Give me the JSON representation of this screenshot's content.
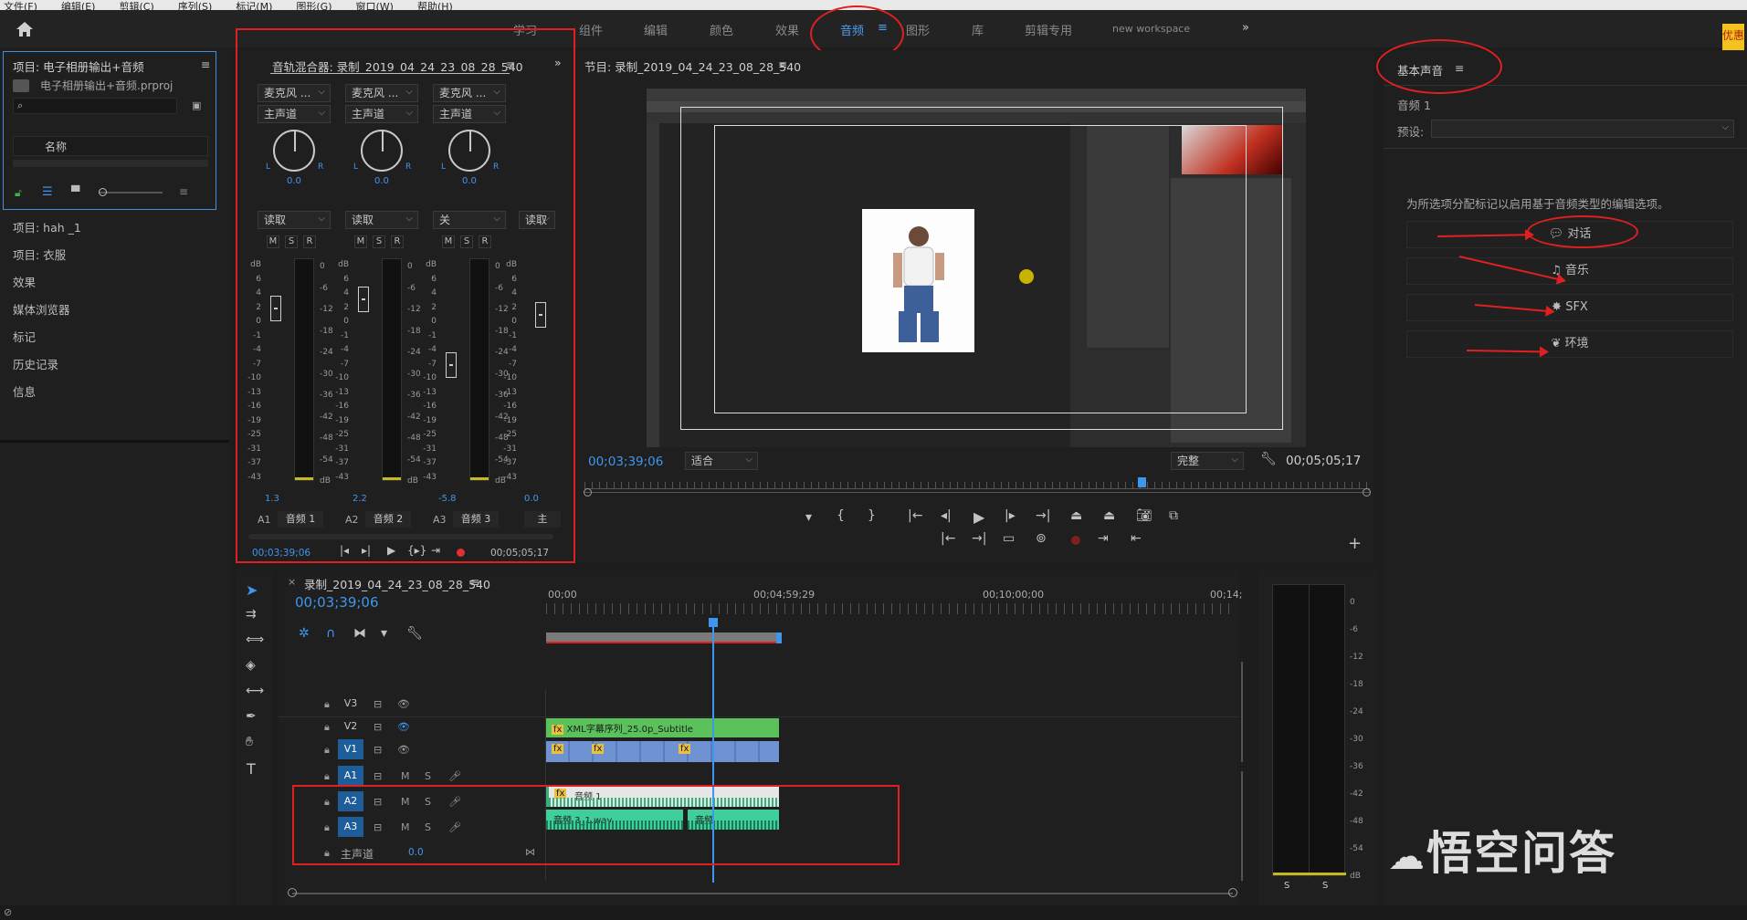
{
  "menu": [
    "文件(F)",
    "编辑(E)",
    "剪辑(C)",
    "序列(S)",
    "标记(M)",
    "图形(G)",
    "窗口(W)",
    "帮助(H)"
  ],
  "workspaces": {
    "tabs": [
      {
        "label": "学习",
        "active": false
      },
      {
        "label": "组件",
        "active": false
      },
      {
        "label": "编辑",
        "active": false
      },
      {
        "label": "颜色",
        "active": false
      },
      {
        "label": "效果",
        "active": false
      },
      {
        "label": "音频",
        "active": true
      },
      {
        "label": "图形",
        "active": false
      },
      {
        "label": "库",
        "active": false
      },
      {
        "label": "剪辑专用",
        "active": false
      },
      {
        "label": "new workspace",
        "active": false
      }
    ],
    "more": "»"
  },
  "project": {
    "title": "项目: 电子相册输出+音频",
    "file": "电子相册输出+音频.prproj",
    "column_name": "名称",
    "search_placeholder": ""
  },
  "left_tabs": [
    "项目: hah _1",
    "项目: 衣服",
    "效果",
    "媒体浏览器",
    "标记",
    "历史记录",
    "信息"
  ],
  "mixer": {
    "title": "音轨混合器: 录制_2019_04_24_23_08_28_540",
    "channels": [
      {
        "input": "麦克风 ...",
        "output": "主声道",
        "mode": "读取",
        "value": "0.0",
        "fader_db": "1.3",
        "track": "A1",
        "name": "音频 1",
        "level": 0.83
      },
      {
        "input": "麦克风 ...",
        "output": "主声道",
        "mode": "读取",
        "value": "0.0",
        "fader_db": "2.2",
        "track": "A2",
        "name": "音频 2",
        "level": 0.87
      },
      {
        "input": "麦克风 ...",
        "output": "主声道",
        "mode": "关",
        "value": "0.0",
        "fader_db": "-5.8",
        "track": "A3",
        "name": "音频 3",
        "level": 0.57
      },
      {
        "mode": "读取",
        "fader_db": "0.0",
        "name": "主",
        "level": 0.8
      }
    ],
    "msr": [
      "M",
      "S",
      "R"
    ],
    "db_scale_left": [
      "dB",
      "6",
      "4",
      "2",
      "0",
      "-1",
      "-4",
      "-7",
      "-10",
      "-13",
      "-16",
      "-19",
      "-25",
      "-31",
      "-37",
      "-43"
    ],
    "db_scale_right": [
      "0",
      "-6",
      "-12",
      "-18",
      "-24",
      "-30",
      "-36",
      "-42",
      "-48",
      "-54",
      "dB"
    ],
    "knob_lr": [
      "L",
      "R"
    ],
    "timecode_left": "00;03;39;06",
    "timecode_right": "00;05;05;17"
  },
  "program": {
    "title": "节目: 录制_2019_04_24_23_08_28_540",
    "timecode": "00;03;39;06",
    "fit": "适合",
    "quality": "完整",
    "duration": "00;05;05;17"
  },
  "essential_sound": {
    "title": "基本声音",
    "clip": "音频 1",
    "preset_label": "预设:",
    "hint": "为所选项分配标记以启用基于音频类型的编辑选项。",
    "buttons": [
      {
        "label": "对话",
        "icon": "speech-bubble-icon"
      },
      {
        "label": "音乐",
        "icon": "music-note-icon"
      },
      {
        "label": "SFX",
        "icon": "burst-icon"
      },
      {
        "label": "环境",
        "icon": "leaf-icon"
      }
    ]
  },
  "timeline": {
    "title": "录制_2019_04_24_23_08_28_540",
    "timecode": "00;03;39;06",
    "ruler": [
      "00;00",
      "00;04;59;29",
      "00;10;00;00",
      "00;14;"
    ],
    "tracks": [
      {
        "id": "V3",
        "type": "video"
      },
      {
        "id": "V2",
        "type": "video"
      },
      {
        "id": "V1",
        "type": "video",
        "selected": true
      },
      {
        "id": "A1",
        "type": "audio",
        "selected": true
      },
      {
        "id": "A2",
        "type": "audio",
        "selected": true
      },
      {
        "id": "A3",
        "type": "audio",
        "selected": true
      }
    ],
    "master": {
      "label": "主声道",
      "value": "0.0"
    },
    "clips": {
      "v2": "XML字幕序列_25.0p_Subtitle",
      "a2": "音频 1",
      "a3a": "音频 3_1.wav",
      "a3b": "音频"
    }
  },
  "meter_bottom": [
    "S",
    "S"
  ],
  "meter_scale": [
    "0",
    "-6",
    "-12",
    "-18",
    "-24",
    "-30",
    "-36",
    "-42",
    "-48",
    "-54",
    "dB"
  ],
  "watermark": "悟空问答",
  "promo_badge": "优惠"
}
